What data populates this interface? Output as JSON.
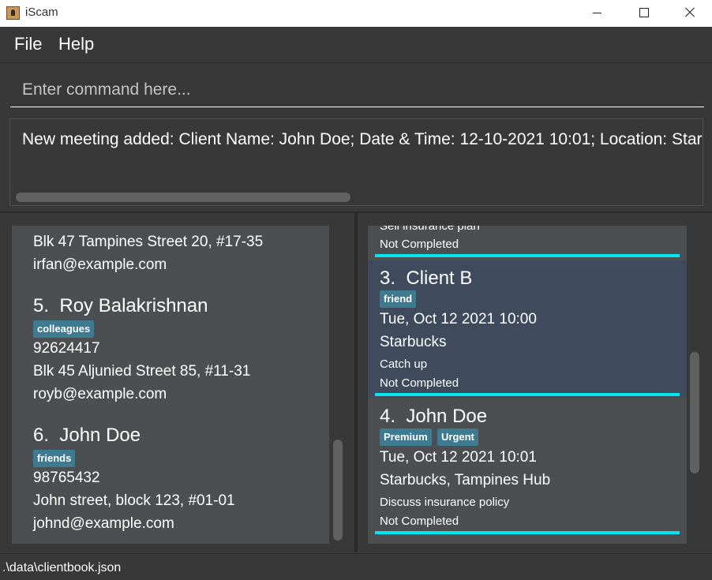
{
  "window": {
    "title": "iScam"
  },
  "menu": {
    "file": "File",
    "help": "Help"
  },
  "command": {
    "placeholder": "Enter command here..."
  },
  "result": {
    "text": "New meeting added: Client Name: John Doe; Date & Time: 12-10-2021 10:01; Location: Starbucks, Tampines Hub"
  },
  "clients": [
    {
      "address": "Blk 47 Tampines Street 20, #17-35",
      "email": "irfan@example.com"
    },
    {
      "index": "5.",
      "name": "Roy Balakrishnan",
      "tags": [
        "colleagues"
      ],
      "phone": "92624417",
      "address": "Blk 45 Aljunied Street 85, #11-31",
      "email": "royb@example.com"
    },
    {
      "index": "6.",
      "name": "John Doe",
      "tags": [
        "friends"
      ],
      "phone": "98765432",
      "address": "John street, block 123, #01-01",
      "email": "johnd@example.com"
    }
  ],
  "meetings": [
    {
      "description": "Sell insurance plan",
      "status": "Not Completed"
    },
    {
      "index": "3.",
      "name": "Client B",
      "tags": [
        "friend"
      ],
      "datetime": "Tue, Oct 12 2021 10:00",
      "location": "Starbucks",
      "description": "Catch up",
      "status": "Not Completed"
    },
    {
      "index": "4.",
      "name": "John Doe",
      "tags": [
        "Premium",
        "Urgent"
      ],
      "datetime": "Tue, Oct 12 2021 10:01",
      "location": "Starbucks, Tampines Hub",
      "description": "Discuss insurance policy",
      "status": "Not Completed"
    }
  ],
  "status": {
    "path": ".\\data\\clientbook.json"
  },
  "colors": {
    "background": "#383838",
    "card": "#4c4f52",
    "selected": "#3f4a5c",
    "tag": "#3e7b91",
    "accent": "#00e5ee"
  }
}
